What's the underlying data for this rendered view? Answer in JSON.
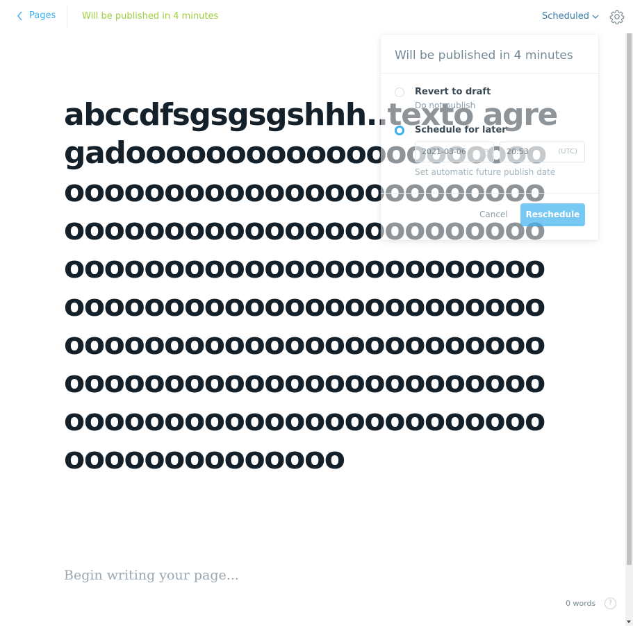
{
  "topbar": {
    "back_label": "Pages",
    "publish_status": "Will be published in 4 minutes",
    "status_dropdown_label": "Scheduled"
  },
  "editor": {
    "title": "abccdfsgsgsgshhh..texto agregadooooooooooooooooooooooooooooooooooooooooooooooooooooooooooooooooooooooooooooooooooooooooooooooooooooooooooooooooooooooooooooooooooooooooooooooooooooooooooooooooooooooooooooooooooooooooooooooooooooooooooo",
    "body_placeholder": "Begin writing your page..."
  },
  "footer": {
    "word_count": "0 words",
    "help_glyph": "?"
  },
  "publish_popover": {
    "title": "Will be published in 4 minutes",
    "option_draft_label": "Revert to draft",
    "option_draft_sub": "Do not publish",
    "option_schedule_label": "Schedule for later",
    "date_value": "2021-03-06",
    "time_value": "20:53",
    "timezone": "(UTC)",
    "schedule_hint": "Set automatic future publish date",
    "cancel_label": "Cancel",
    "confirm_label": "Reschedule",
    "selected_option": "schedule"
  },
  "colors": {
    "accent": "#3eb0ef",
    "published_green": "#9fcf3a",
    "title_text": "#15212a",
    "muted": "#738a94"
  }
}
